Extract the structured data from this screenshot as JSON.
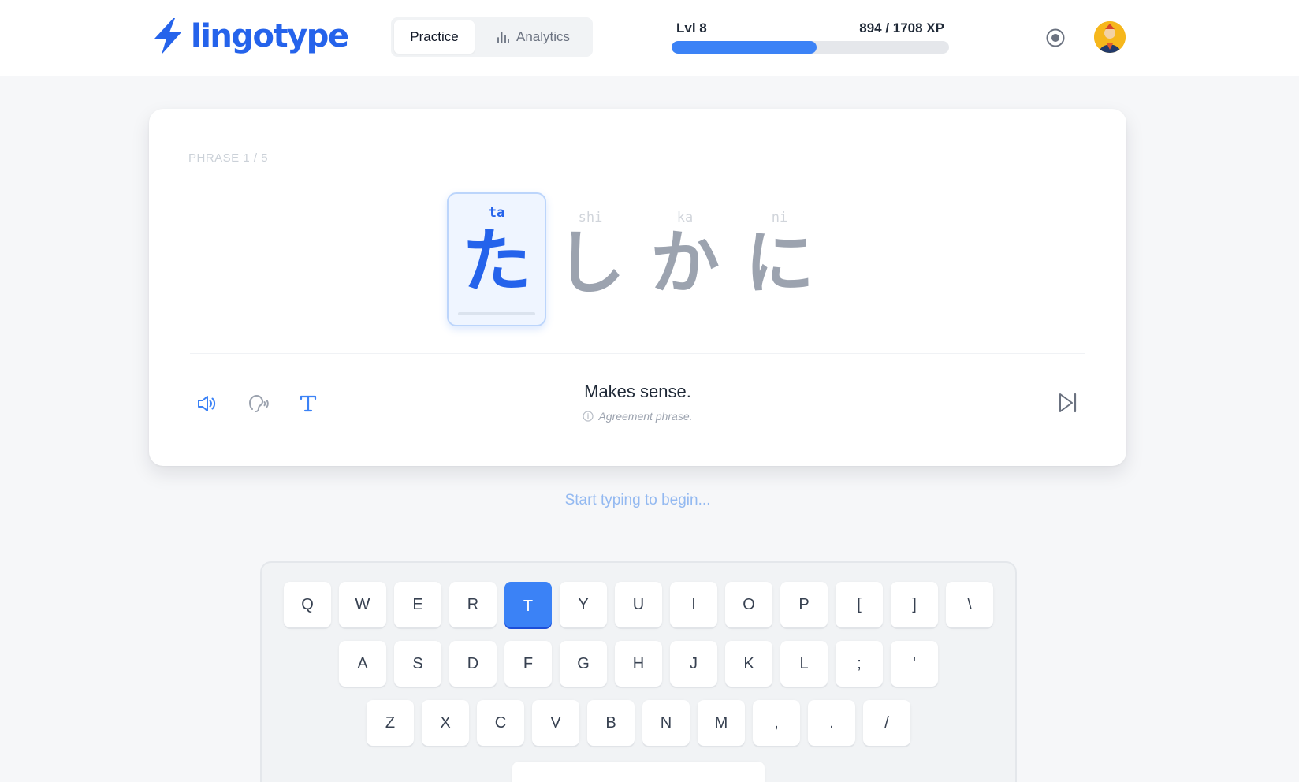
{
  "app": {
    "name": "lingotype",
    "brand_color": "#2563eb",
    "accent_color": "#3b82f6"
  },
  "nav": {
    "tabs": [
      {
        "label": "Practice",
        "active": true,
        "icon": ""
      },
      {
        "label": "Analytics",
        "active": false,
        "icon": "bar-chart-icon"
      }
    ]
  },
  "progress": {
    "level_label": "Lvl 8",
    "xp_label": "894 / 1708 XP",
    "xp_current": 894,
    "xp_total": 1708
  },
  "header_icons": {
    "record": "record-icon",
    "avatar": "user-avatar"
  },
  "phrase": {
    "counter": "PHRASE 1 / 5",
    "characters": [
      {
        "romaji": "ta",
        "kana": "た",
        "active": true
      },
      {
        "romaji": "shi",
        "kana": "し",
        "active": false
      },
      {
        "romaji": "ka",
        "kana": "か",
        "active": false
      },
      {
        "romaji": "ni",
        "kana": "に",
        "active": false
      }
    ],
    "translation": "Makes sense.",
    "note": "Agreement phrase."
  },
  "tools": {
    "audio": "speaker-icon",
    "listen": "listen-icon",
    "text": "text-icon",
    "skip": "skip-forward-icon"
  },
  "hint": "Start typing to begin...",
  "keyboard": {
    "active_key": "T",
    "rows": [
      [
        "Q",
        "W",
        "E",
        "R",
        "T",
        "Y",
        "U",
        "I",
        "O",
        "P",
        "[",
        "]",
        "\\"
      ],
      [
        "A",
        "S",
        "D",
        "F",
        "G",
        "H",
        "J",
        "K",
        "L",
        ";",
        "'"
      ],
      [
        "Z",
        "X",
        "C",
        "V",
        "B",
        "N",
        "M",
        ",",
        ".",
        "/"
      ]
    ]
  }
}
